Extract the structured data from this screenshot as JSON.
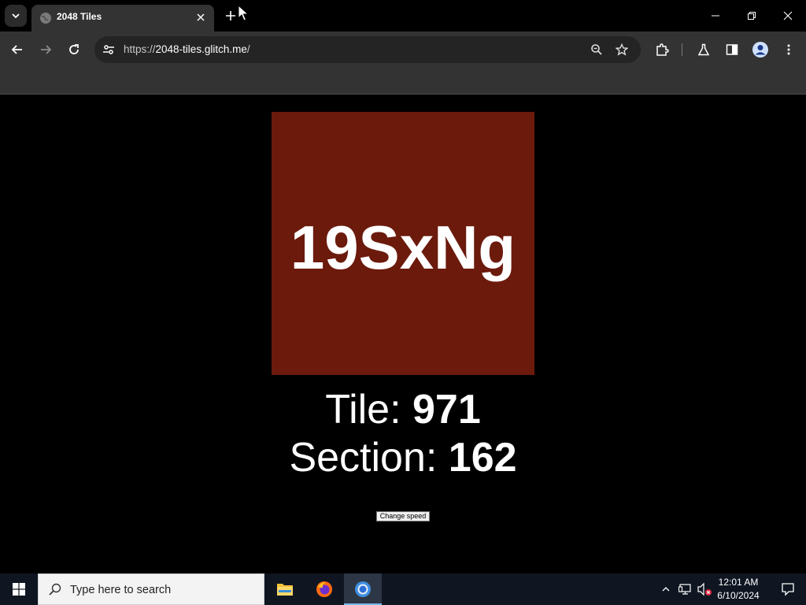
{
  "browser": {
    "tab_title": "2048 Tiles",
    "url_scheme": "https://",
    "url_host": "2048-tiles.glitch.me",
    "url_path": "/"
  },
  "game": {
    "tile_label": "19SxNg",
    "tile_color": "#6b1a0c",
    "tile_prefix": "Tile: ",
    "tile_number": "971",
    "section_prefix": "Section: ",
    "section_number": "162",
    "speed_button": "Change speed"
  },
  "taskbar": {
    "search_placeholder": "Type here to search",
    "time": "12:01 AM",
    "date": "6/10/2024"
  }
}
